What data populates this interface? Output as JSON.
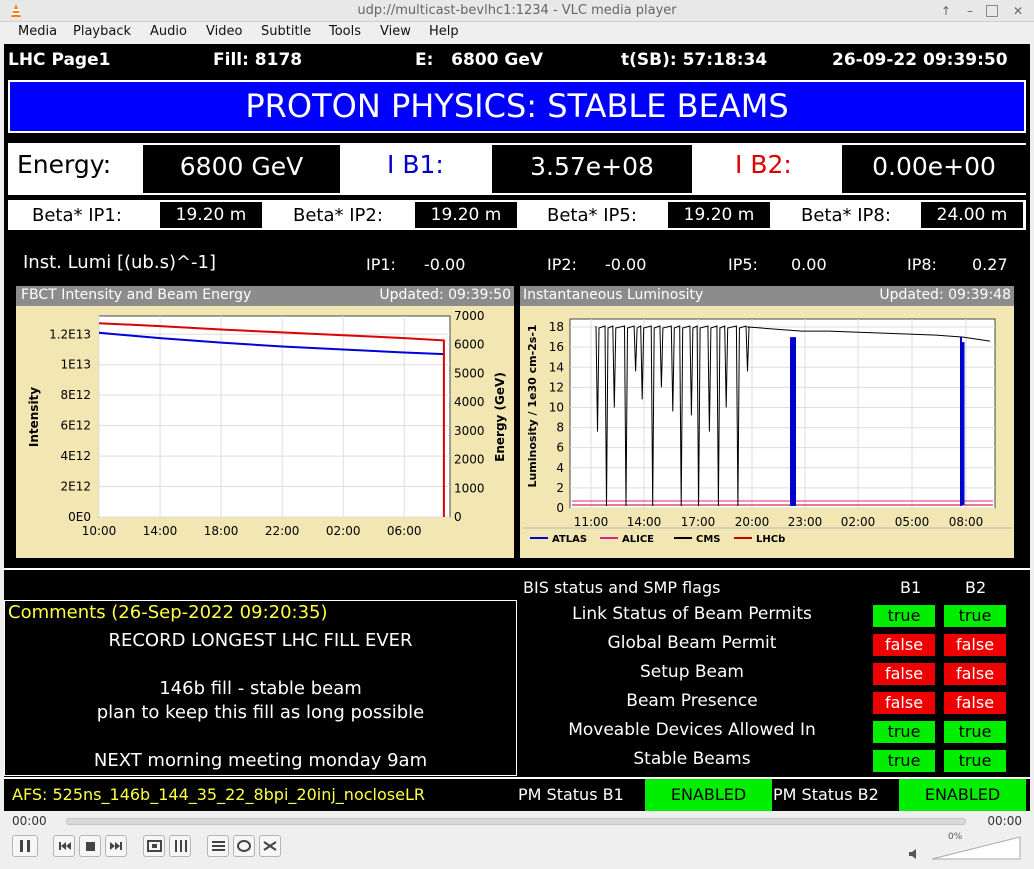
{
  "window": {
    "title": "udp://multicast-bevlhc1:1234 - VLC media player",
    "menu": [
      "Media",
      "Playback",
      "Audio",
      "Video",
      "Subtitle",
      "Tools",
      "View",
      "Help"
    ]
  },
  "header": {
    "page": "LHC Page1",
    "fill": "Fill: 8178",
    "energy": "E:   6800 GeV",
    "tsb": "t(SB): 57:18:34",
    "datetime": "26-09-22 09:39:50"
  },
  "banner": "PROTON PHYSICS: STABLE BEAMS",
  "energy_row": {
    "energy_label": "Energy:",
    "energy_value": "6800 GeV",
    "ib1_label": "I B1:",
    "ib1_value": "3.57e+08",
    "ib2_label": "I B2:",
    "ib2_value": "0.00e+00"
  },
  "beta": [
    {
      "label": "Beta* IP1:",
      "value": "19.20 m"
    },
    {
      "label": "Beta* IP2:",
      "value": "19.20 m"
    },
    {
      "label": "Beta* IP5:",
      "value": "19.20 m"
    },
    {
      "label": "Beta* IP8:",
      "value": "24.00 m"
    }
  ],
  "lumi": {
    "label": "Inst. Lumi [(ub.s)^-1]",
    "ips": [
      {
        "label": "IP1:",
        "value": "-0.00"
      },
      {
        "label": "IP2:",
        "value": "-0.00"
      },
      {
        "label": "IP5:",
        "value": "0.00"
      },
      {
        "label": "IP8:",
        "value": "0.27"
      }
    ]
  },
  "chart_data": [
    {
      "type": "line",
      "title": "FBCT Intensity and Beam Energy",
      "updated": "Updated: 09:39:50",
      "ylabel": "Intensity",
      "y2label": "Energy (GeV)",
      "x_ticks": [
        "10:00",
        "14:00",
        "18:00",
        "22:00",
        "02:00",
        "06:00"
      ],
      "y_ticks": [
        "1.2E13",
        "1E13",
        "8E12",
        "6E12",
        "4E12",
        "2E12",
        "0E0"
      ],
      "y2_ticks": [
        "7000",
        "6000",
        "5000",
        "4000",
        "3000",
        "2000",
        "1000",
        "0"
      ],
      "x_hours": [
        0,
        4,
        8,
        12,
        16,
        20,
        22.6
      ],
      "series": [
        {
          "name": "Intensity",
          "color": "#0000dd",
          "axis": "left",
          "values": [
            12100000000000.0,
            11750000000000.0,
            11450000000000.0,
            11200000000000.0,
            11000000000000.0,
            10800000000000.0,
            10700000000000.0
          ]
        },
        {
          "name": "Energy",
          "color": "#dd0000",
          "axis": "right",
          "values": [
            6750,
            6650,
            6530,
            6430,
            6330,
            6230,
            6150
          ]
        }
      ],
      "ylim": [
        0,
        13200000000000.0
      ],
      "y2lim": [
        0,
        7000
      ],
      "grid": true
    },
    {
      "type": "line",
      "title": "Instantaneous Luminosity",
      "updated": "Updated: 09:39:48",
      "ylabel": "Luminosity / 1e30 cm-2s-1",
      "x_ticks": [
        "11:00",
        "14:00",
        "17:00",
        "20:00",
        "23:00",
        "02:00",
        "05:00",
        "08:00"
      ],
      "y_ticks": [
        "18",
        "16",
        "14",
        "12",
        "10",
        "8",
        "6",
        "4",
        "2",
        "0"
      ],
      "ylim": [
        0,
        18.8
      ],
      "grid": true,
      "legend": [
        "ATLAS",
        "ALICE",
        "CMS",
        "LHCb"
      ],
      "legend_colors": [
        "#0000cc",
        "#dd2299",
        "#000000",
        "#cc0000"
      ],
      "cms_baseline": [
        18.0,
        17.8,
        17.6,
        17.6,
        17.5,
        17.4,
        17.3,
        17.2,
        17.0,
        16.6
      ],
      "alice_level": 0.7,
      "lhcb_level": 0.3
    }
  ],
  "bis": {
    "title": "BIS status and SMP flags",
    "b1": "B1",
    "b2": "B2",
    "rows": [
      {
        "label": "Link Status of Beam Permits",
        "b1": "true",
        "b2": "true"
      },
      {
        "label": "Global Beam Permit",
        "b1": "false",
        "b2": "false"
      },
      {
        "label": "Setup Beam",
        "b1": "false",
        "b2": "false"
      },
      {
        "label": "Beam Presence",
        "b1": "false",
        "b2": "false"
      },
      {
        "label": "Moveable Devices Allowed In",
        "b1": "true",
        "b2": "true"
      },
      {
        "label": "Stable Beams",
        "b1": "true",
        "b2": "true"
      }
    ]
  },
  "comments": {
    "title": "Comments (26-Sep-2022 09:20:35)",
    "lines": [
      "RECORD LONGEST LHC FILL EVER",
      "",
      "146b fill - stable beam",
      "plan to keep this fill as long possible",
      "",
      "NEXT morning meeting monday 9am"
    ]
  },
  "footer": {
    "afs": "AFS: 525ns_146b_144_35_22_8bpi_20inj_nocloseLR",
    "pm_b1_label": "PM Status B1",
    "pm_b1_value": "ENABLED",
    "pm_b2_label": "PM Status B2",
    "pm_b2_value": "ENABLED"
  },
  "player": {
    "time_left": "00:00",
    "time_right": "00:00",
    "volume": "0%",
    "volume_level": 0
  }
}
